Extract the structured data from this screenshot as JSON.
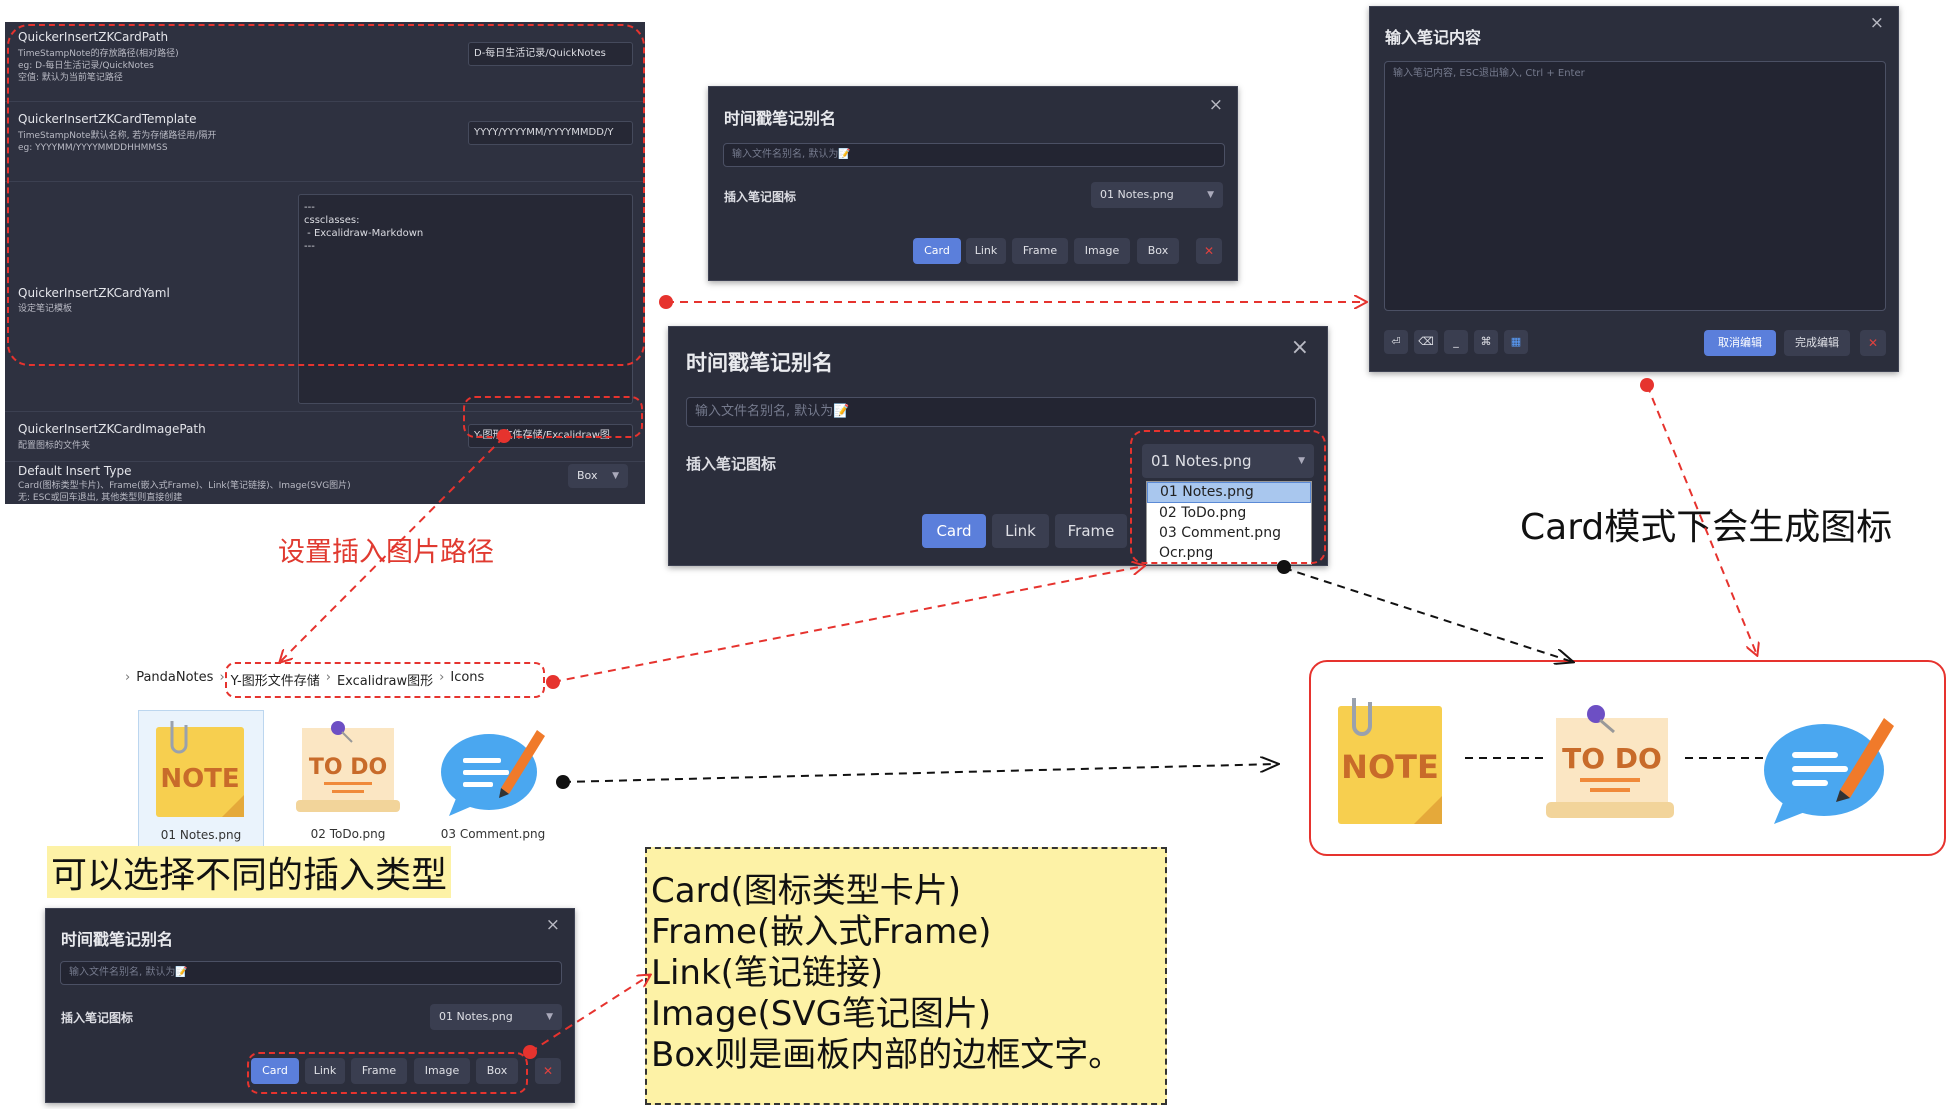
{
  "settings": {
    "rows": [
      {
        "name": "QuickerInsertZKCardPath",
        "desc": "TimeStampNote的存放路径(相对路径)\neg: D-每日生活记录/QuickNotes\n空值: 默认为当前笔记路径",
        "value": "D-每日生活记录/QuickNotes"
      },
      {
        "name": "QuickerInsertZKCardTemplate",
        "desc": "TimeStampNote默认名称, 若为存储路径用/隔开\neg: YYYYMM/YYYYMMDDHHMMSS",
        "value": "YYYY/YYYYMM/YYYYMMDD/Y"
      },
      {
        "name": "QuickerInsertZKCardYaml",
        "desc": "设定笔记模板",
        "value": "---\ncssclasses:\n - Excalidraw-Markdown\n---"
      },
      {
        "name": "QuickerInsertZKCardImagePath",
        "desc": "配置图标的文件夹",
        "value": "Y-图形文件存储/Excalidraw图"
      },
      {
        "name": "Default Insert Type",
        "desc": "Card(图标类型卡片)、Frame(嵌入式Frame)、Link(笔记链接)、Image(SVG图片)\n无: ESC或回车退出, 其他类型则直接创建",
        "value": "Box"
      }
    ]
  },
  "dialog_small": {
    "title": "时间戳笔记别名",
    "close": "×",
    "placeholder": "输入文件名别名, 默认为📝",
    "icon_label": "插入笔记图标",
    "icon_value": "01 Notes.png",
    "buttons": [
      "Card",
      "Link",
      "Frame",
      "Image",
      "Box",
      "✕"
    ]
  },
  "dialog_large": {
    "title": "时间戳笔记别名",
    "close": "×",
    "placeholder": "输入文件名别名, 默认为📝",
    "icon_label": "插入笔记图标",
    "icon_value": "01 Notes.png",
    "buttons": [
      "Card",
      "Link",
      "Frame"
    ],
    "options": [
      "01 Notes.png",
      "02 ToDo.png",
      "03 Comment.png",
      "Ocr.png"
    ]
  },
  "dialog_bottom": {
    "title": "时间戳笔记别名",
    "close": "×",
    "placeholder": "输入文件名别名, 默认为📝",
    "icon_label": "插入笔记图标",
    "icon_value": "01 Notes.png",
    "buttons": [
      "Card",
      "Link",
      "Frame",
      "Image",
      "Box",
      "✕"
    ]
  },
  "note_editor": {
    "title": "输入笔记内容",
    "close": "×",
    "placeholder": "输入笔记内容, ESC退出输入, Ctrl + Enter",
    "cancel": "取消编辑",
    "done": "完成编辑",
    "x": "✕"
  },
  "breadcrumb": [
    "PandaNotes",
    "Y-图形文件存储",
    "Excalidraw图形",
    "Icons"
  ],
  "files": [
    "01 Notes.png",
    "02 ToDo.png",
    "03 Comment.png"
  ],
  "annotations": {
    "image_path": "设置插入图片路径",
    "card_mode": "Card模式下会生成图标",
    "insert_types": "可以选择不同的插入类型",
    "types_list": [
      "Card(图标类型卡片)",
      "Frame(嵌入式Frame)",
      "Link(笔记链接)",
      "Image(SVG笔记图片)",
      "Box则是画板内部的边框文字。"
    ]
  },
  "icons": {
    "note": "NOTE",
    "todo": "TO DO"
  },
  "colors": {
    "accent": "#5b7fdb",
    "annotation_red": "#e6332e",
    "highlight": "#fdf2a6",
    "panel": "#2f3241"
  }
}
